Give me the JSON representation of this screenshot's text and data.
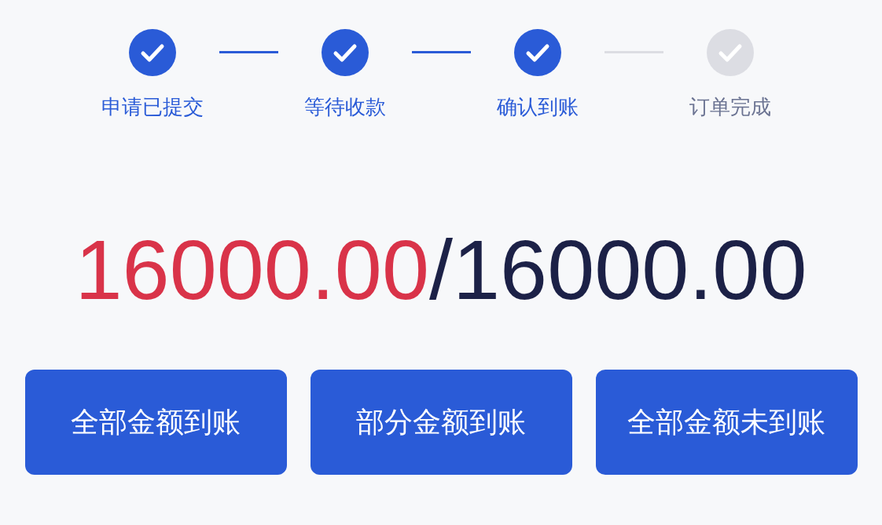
{
  "steps": [
    {
      "label": "申请已提交",
      "done": true
    },
    {
      "label": "等待收款",
      "done": true
    },
    {
      "label": "确认到账",
      "done": true
    },
    {
      "label": "订单完成",
      "done": false
    }
  ],
  "amount": {
    "received": "16000.00",
    "separator": "/",
    "total": "16000.00"
  },
  "buttons": [
    "全部金额到账",
    "部分金额到账",
    "全部金额未到账"
  ]
}
